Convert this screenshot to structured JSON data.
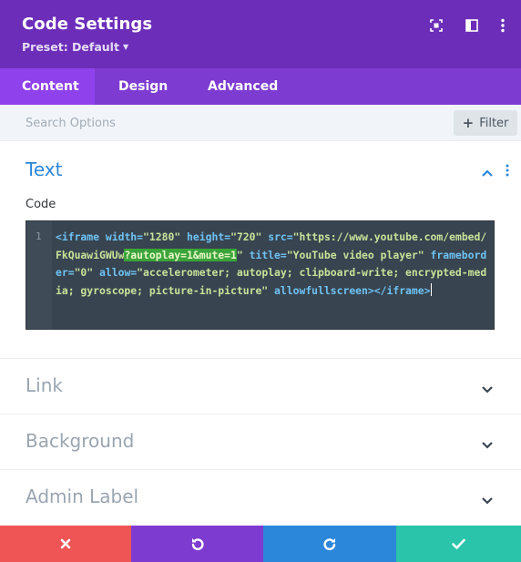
{
  "header": {
    "title": "Code Settings",
    "preset_label": "Preset: Default",
    "bg_color": "#6c2eb9",
    "icons": [
      "expand-icon",
      "split-view-icon",
      "more-vertical-icon"
    ]
  },
  "tabs": [
    {
      "label": "Content",
      "active": true
    },
    {
      "label": "Design",
      "active": false
    },
    {
      "label": "Advanced",
      "active": false
    }
  ],
  "search": {
    "placeholder": "Search Options",
    "value": "",
    "filter_label": "Filter"
  },
  "sections": {
    "text": {
      "title": "Text",
      "expanded": true,
      "field_label": "Code",
      "line_number": "1",
      "code": {
        "tag_open": "<iframe",
        "attr_width": "width=",
        "val_width": "\"1280\"",
        "attr_height": "height=",
        "val_height": "\"720\"",
        "attr_src": "src=",
        "val_src_a": "\"https://www.youtube.com/embed/FkQuawiGWUw",
        "val_src_hl": "?autoplay=1&mute=1",
        "val_src_b": "\"",
        "attr_title": "title=",
        "val_title": "\"YouTube video player\"",
        "attr_frameborder": "frameborder=",
        "val_frameborder": "\"0\"",
        "attr_allow": "allow=",
        "val_allow": "\"accelerometer; autoplay; clipboard-write; encrypted-media; gyroscope; picture-in-picture\"",
        "attr_fullscreen": "allowfullscreen",
        "tag_gt": ">",
        "tag_close": "</iframe>"
      }
    },
    "link": {
      "title": "Link",
      "expanded": false
    },
    "background": {
      "title": "Background",
      "expanded": false
    },
    "admin_label": {
      "title": "Admin Label",
      "expanded": false
    }
  },
  "footer": {
    "buttons": [
      {
        "name": "cancel",
        "icon": "close-icon",
        "color": "#ef5555"
      },
      {
        "name": "undo",
        "icon": "undo-icon",
        "color": "#7e3bd0"
      },
      {
        "name": "redo",
        "icon": "redo-icon",
        "color": "#2b87da"
      },
      {
        "name": "save",
        "icon": "check-icon",
        "color": "#29c4a9"
      }
    ]
  },
  "colors": {
    "accent_blue": "#2b87da",
    "tab_bar": "#7d3bd1",
    "tab_active": "#8f42ec",
    "editor_bg": "#38444f",
    "highlight_green": "#3aa43a"
  }
}
